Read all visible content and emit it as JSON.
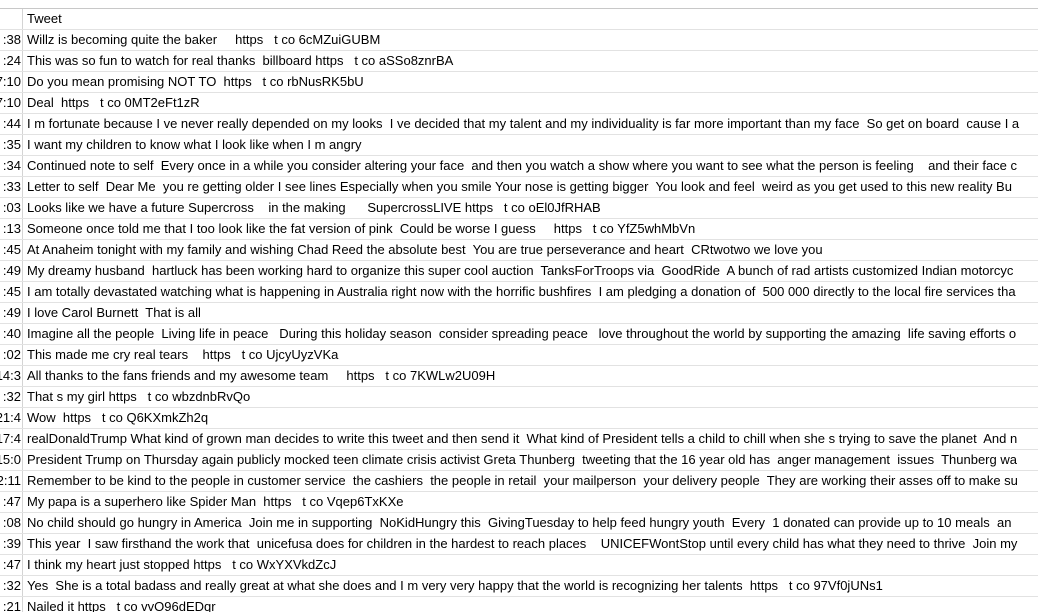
{
  "header": {
    "col_a": "",
    "col_b": "Tweet"
  },
  "rows": [
    {
      "time": ":38",
      "tweet": "Willz is becoming quite the baker     https   t co 6cMZuiGUBM"
    },
    {
      "time": ":24",
      "tweet": "This was so fun to watch for real thanks  billboard https   t co aSSo8znrBA"
    },
    {
      "time": "7:10",
      "tweet": "Do you mean promising NOT TO  https   t co rbNusRK5bU"
    },
    {
      "time": "7:10",
      "tweet": "Deal  https   t co 0MT2eFt1zR"
    },
    {
      "time": ":44",
      "tweet": "I m fortunate because I ve never really depended on my looks  I ve decided that my talent and my individuality is far more important than my face  So get on board  cause I a"
    },
    {
      "time": ":35",
      "tweet": "I want my children to know what I look like when I m angry"
    },
    {
      "time": ":34",
      "tweet": "Continued note to self  Every once in a while you consider altering your face  and then you watch a show where you want to see what the person is feeling    and their face c"
    },
    {
      "time": ":33",
      "tweet": "Letter to self  Dear Me  you re getting older I see lines Especially when you smile Your nose is getting bigger  You look and feel  weird as you get used to this new reality Bu"
    },
    {
      "time": ":03",
      "tweet": "Looks like we have a future Supercross    in the making      SupercrossLIVE https   t co oEl0JfRHAB"
    },
    {
      "time": ":13",
      "tweet": "Someone once told me that I too look like the fat version of pink  Could be worse I guess     https   t co YfZ5whMbVn"
    },
    {
      "time": ":45",
      "tweet": "At Anaheim tonight with my family and wishing Chad Reed the absolute best  You are true perseverance and heart  CRtwotwo we love you"
    },
    {
      "time": ":49",
      "tweet": "My dreamy husband  hartluck has been working hard to organize this super cool auction  TanksForTroops via  GoodRide  A bunch of rad artists customized Indian motorcyc"
    },
    {
      "time": ":45",
      "tweet": "I am totally devastated watching what is happening in Australia right now with the horrific bushfires  I am pledging a donation of  500 000 directly to the local fire services tha"
    },
    {
      "time": ":49",
      "tweet": "I love Carol Burnett  That is all"
    },
    {
      "time": ":40",
      "tweet": "Imagine all the people  Living life in peace   During this holiday season  consider spreading peace   love throughout the world by supporting the amazing  life saving efforts o"
    },
    {
      "time": ":02",
      "tweet": "This made me cry real tears    https   t co UjcyUyzVKa"
    },
    {
      "time": "14:3",
      "tweet": "All thanks to the fans friends and my awesome team     https   t co 7KWLw2U09H"
    },
    {
      "time": ":32",
      "tweet": "That s my girl https   t co wbzdnbRvQo"
    },
    {
      "time": "21:4",
      "tweet": "Wow  https   t co Q6KXmkZh2q"
    },
    {
      "time": "17:4",
      "tweet": "realDonaldTrump What kind of grown man decides to write this tweet and then send it  What kind of President tells a child to chill when she s trying to save the planet  And n"
    },
    {
      "time": "15:0",
      "tweet": "President Trump on Thursday again publicly mocked teen climate crisis activist Greta Thunberg  tweeting that the 16 year old has  anger management  issues  Thunberg wa"
    },
    {
      "time": "2:11",
      "tweet": "Remember to be kind to the people in customer service  the cashiers  the people in retail  your mailperson  your delivery people  They are working their asses off to make su"
    },
    {
      "time": ":47",
      "tweet": "My papa is a superhero like Spider Man  https   t co Vqep6TxKXe"
    },
    {
      "time": ":08",
      "tweet": "No child should go hungry in America  Join me in supporting  NoKidHungry this  GivingTuesday to help feed hungry youth  Every  1 donated can provide up to 10 meals  an"
    },
    {
      "time": ":39",
      "tweet": "This year  I saw firsthand the work that  unicefusa does for children in the hardest to reach places    UNICEFWontStop until every child has what they need to thrive  Join my"
    },
    {
      "time": ":47",
      "tweet": "I think my heart just stopped https   t co WxYXVkdZcJ"
    },
    {
      "time": ":32",
      "tweet": "Yes  She is a total badass and really great at what she does and I m very very happy that the world is recognizing her talents  https   t co 97Vf0jUNs1"
    },
    {
      "time": ":21",
      "tweet": "Nailed it https   t co vvO96dEDqr"
    }
  ]
}
